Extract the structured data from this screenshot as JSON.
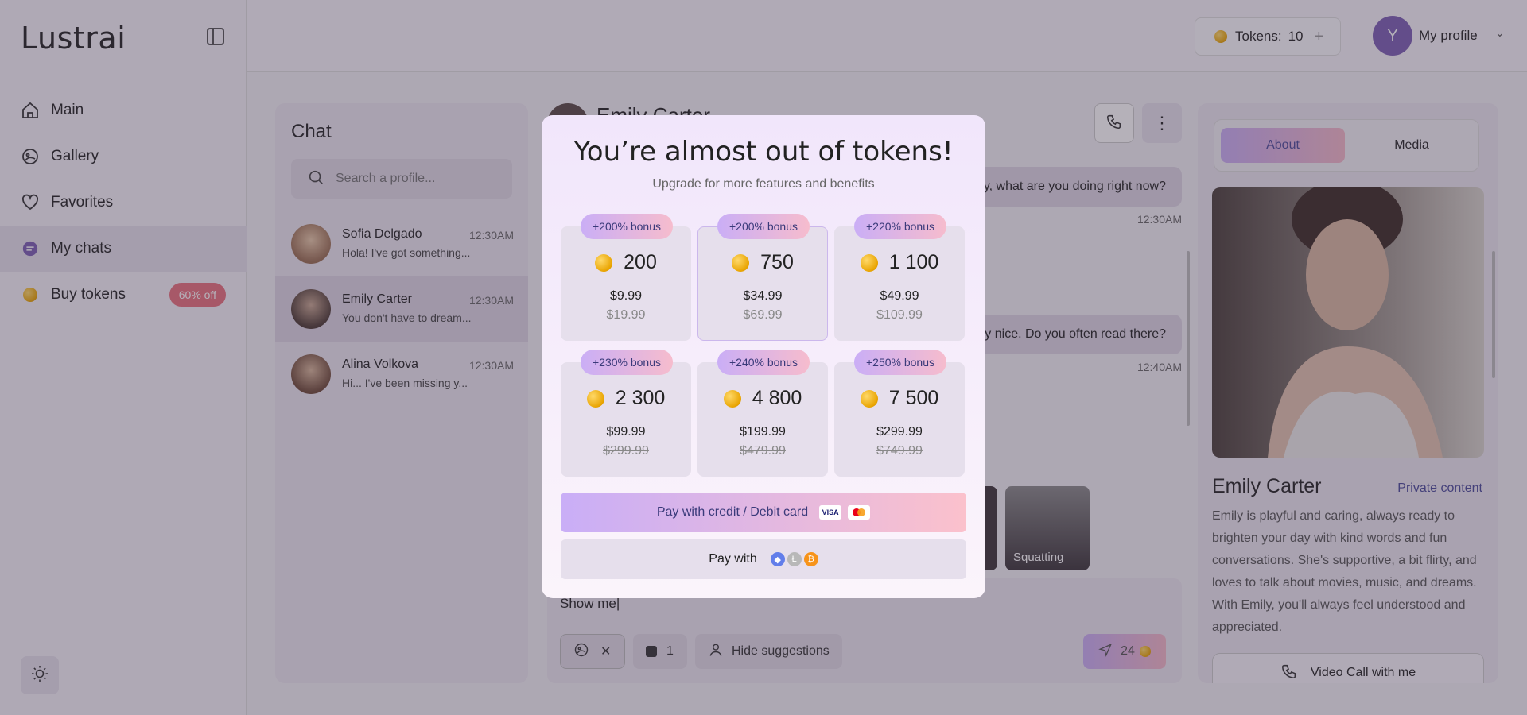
{
  "app": {
    "logo": "Lustrai"
  },
  "nav": [
    {
      "label": "Main",
      "icon": "home-icon"
    },
    {
      "label": "Gallery",
      "icon": "gallery-icon"
    },
    {
      "label": "Favorites",
      "icon": "heart-icon"
    },
    {
      "label": "My chats",
      "icon": "chat-bubble-icon"
    },
    {
      "label": "Buy tokens",
      "icon": "coin-icon",
      "badge": "60% off"
    }
  ],
  "topbar": {
    "tokens_label": "Tokens:",
    "tokens_count": "10",
    "avatar_letter": "Y",
    "profile_label": "My profile"
  },
  "chat_list": {
    "title": "Chat",
    "search_placeholder": "Search a profile...",
    "items": [
      {
        "name": "Sofia Delgado",
        "time": "12:30AM",
        "message": "Hola! I've got something..."
      },
      {
        "name": "Emily Carter",
        "time": "12:30AM",
        "message": "You don't have to dream..."
      },
      {
        "name": "Alina Volkova",
        "time": "12:30AM",
        "message": "Hi... I've been missing y..."
      }
    ]
  },
  "chat": {
    "header_name": "Emily Carter",
    "messages": [
      {
        "text": "y, what are you doing right now?",
        "time": "12:30AM"
      },
      {
        "text": "ly nice. Do you often read there?",
        "time": "12:40AM"
      }
    ],
    "suggestion_label": "Squatting",
    "composer_text": "Show me|",
    "photo_count": "1",
    "hide_suggestions": "Hide suggestions",
    "send_cost": "24"
  },
  "profile_panel": {
    "tab_about": "About",
    "tab_media": "Media",
    "name": "Emily Carter",
    "private_link": "Private content",
    "description": "Emily is playful and caring, always ready to brighten your day with kind words and fun conversations. She's supportive, a bit flirty, and loves to talk about movies, music, and dreams. With Emily, you'll always feel understood and appreciated.",
    "video_call": "Video Call with me"
  },
  "modal": {
    "title": "You’re almost out of tokens!",
    "subtitle": "Upgrade for more features and benefits",
    "packs": [
      {
        "bonus": "+200% bonus",
        "amount": "200",
        "price": "$9.99",
        "old_price": "$19.99"
      },
      {
        "bonus": "+200% bonus",
        "amount": "750",
        "price": "$34.99",
        "old_price": "$69.99"
      },
      {
        "bonus": "+220% bonus",
        "amount": "1 100",
        "price": "$49.99",
        "old_price": "$109.99"
      },
      {
        "bonus": "+230% bonus",
        "amount": "2 300",
        "price": "$99.99",
        "old_price": "$299.99"
      },
      {
        "bonus": "+240% bonus",
        "amount": "4 800",
        "price": "$199.99",
        "old_price": "$479.99"
      },
      {
        "bonus": "+250% bonus",
        "amount": "7 500",
        "price": "$299.99",
        "old_price": "$749.99"
      }
    ],
    "pay_card_label": "Pay with credit / Debit card",
    "card_logos": [
      "VISA",
      "mastercard"
    ],
    "pay_crypto_label": "Pay with",
    "crypto_icons": [
      "ethereum-icon",
      "litecoin-icon",
      "bitcoin-icon"
    ]
  },
  "colors": {
    "accent": "#7b5eb3",
    "badge": "#e8707c",
    "link": "#4a4a99"
  }
}
